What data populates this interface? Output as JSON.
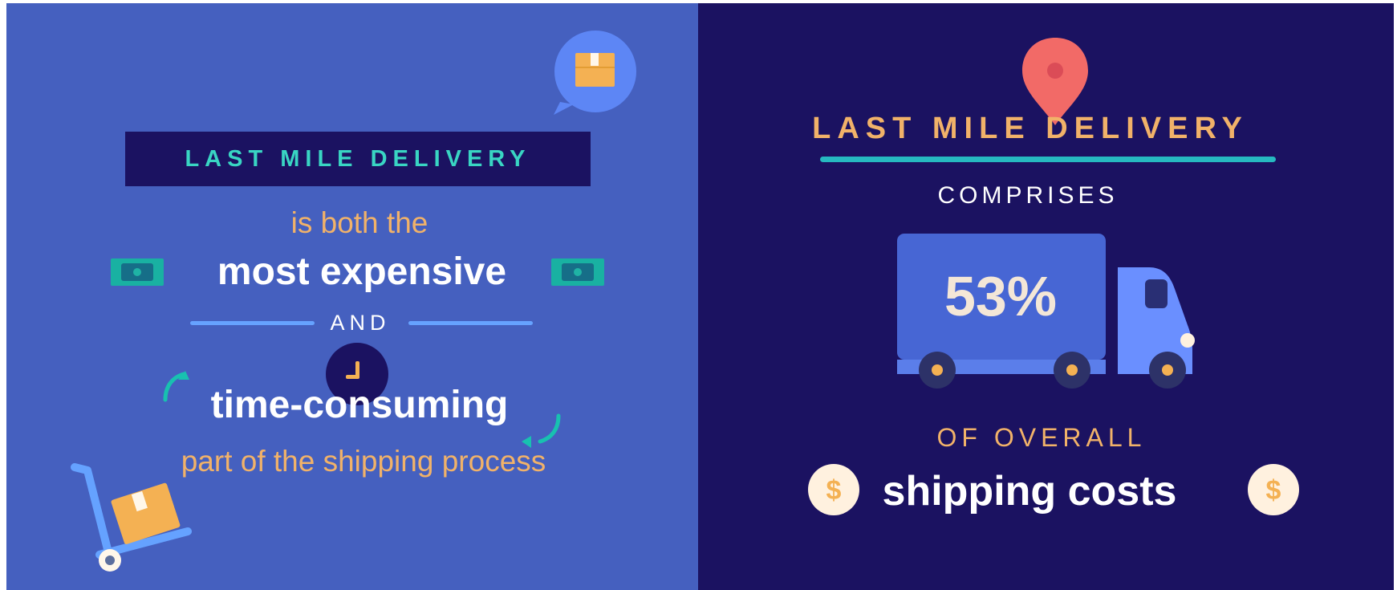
{
  "left_panel": {
    "title": "LAST MILE DELIVERY",
    "line1": "is both the",
    "line2": "most expensive",
    "connector": "AND",
    "line3": "time-consuming",
    "line4": "part of the shipping process",
    "icons": [
      "delivery-chat-icon",
      "money-left-icon",
      "money-right-icon",
      "clock-icon",
      "refresh-arrow-left-icon",
      "refresh-arrow-right-icon",
      "hand-truck-icon"
    ]
  },
  "right_panel": {
    "title": "LAST MILE DELIVERY",
    "subtitle": "COMPRISES",
    "percentage": "53%",
    "line1": "OF OVERALL",
    "line2": "shipping costs",
    "coin_symbol": "$",
    "icons": [
      "map-pin-icon",
      "delivery-truck-icon",
      "dollar-coin-left-icon",
      "dollar-coin-right-icon"
    ]
  },
  "colors": {
    "left_background": "#4560BF",
    "right_background": "#1B1261",
    "accent_teal": "#39D5C3",
    "accent_orange": "#F1B269",
    "accent_blue": "#66A2FF",
    "truck_dark": "#4766D4",
    "truck_light": "#6A8FFF",
    "pin_red": "#F26A67",
    "money_green": "#1FB3A5"
  }
}
